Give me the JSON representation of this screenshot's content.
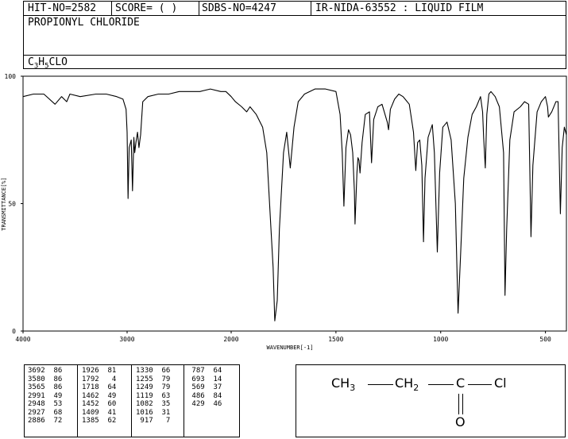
{
  "header": {
    "hit_no": "HIT-NO=2582",
    "score": "SCORE=  (   )",
    "sdbs_no": "SDBS-NO=4247",
    "ir_info": "IR-NIDA-63552 : LIQUID FILM",
    "compound_name": "PROPIONYL CHLORIDE",
    "formula": {
      "c": "C",
      "c_count": "3",
      "h": "H",
      "h_count": "5",
      "rest": "CLO"
    }
  },
  "chart_data": {
    "type": "line",
    "title": "",
    "xlabel": "WAVENUMBER[-1]",
    "ylabel": "TRANSMITTANCE[%]",
    "xlim": [
      4000,
      400
    ],
    "ylim": [
      0,
      100
    ],
    "x_ticks": [
      "4000",
      "3000",
      "2000",
      "1500",
      "1000",
      "500"
    ],
    "x_tick_values": [
      4000,
      3000,
      2000,
      1500,
      1000,
      500
    ],
    "y_ticks": [
      "100",
      "50",
      "0"
    ],
    "y_tick_values": [
      100,
      50,
      0
    ],
    "series": [
      {
        "x": [
          4000,
          3900,
          3800,
          3692,
          3630,
          3580,
          3550,
          3450,
          3300,
          3200,
          3100,
          3040,
          3010,
          3000,
          2991,
          2980,
          2960,
          2948,
          2935,
          2927,
          2915,
          2900,
          2886,
          2870,
          2850,
          2800,
          2700,
          2600,
          2500,
          2400,
          2300,
          2200,
          2100,
          2050,
          2000,
          1980,
          1950,
          1926,
          1910,
          1880,
          1850,
          1830,
          1810,
          1800,
          1792,
          1780,
          1770,
          1750,
          1735,
          1718,
          1700,
          1680,
          1650,
          1600,
          1550,
          1500,
          1480,
          1470,
          1462,
          1455,
          1452,
          1440,
          1430,
          1420,
          1412,
          1409,
          1400,
          1395,
          1390,
          1385,
          1375,
          1360,
          1340,
          1330,
          1320,
          1300,
          1280,
          1255,
          1249,
          1240,
          1220,
          1200,
          1180,
          1150,
          1130,
          1119,
          1110,
          1100,
          1090,
          1082,
          1075,
          1060,
          1040,
          1030,
          1016,
          1005,
          990,
          970,
          950,
          930,
          917,
          905,
          890,
          870,
          850,
          830,
          810,
          800,
          795,
          787,
          780,
          770,
          760,
          740,
          720,
          700,
          693,
          685,
          670,
          650,
          620,
          600,
          580,
          569,
          560,
          540,
          520,
          500,
          490,
          486,
          470,
          450,
          440,
          429,
          420,
          410,
          400
        ],
        "y": [
          92,
          93,
          93,
          89,
          92,
          90,
          93,
          92,
          93,
          93,
          92,
          91,
          87,
          78,
          52,
          72,
          75,
          55,
          76,
          70,
          74,
          78,
          72,
          77,
          90,
          92,
          93,
          93,
          94,
          94,
          94,
          95,
          94,
          94,
          92,
          90,
          88,
          86,
          88,
          85,
          80,
          70,
          40,
          25,
          4,
          12,
          40,
          70,
          78,
          64,
          80,
          90,
          93,
          95,
          95,
          94,
          85,
          70,
          49,
          65,
          72,
          79,
          77,
          70,
          55,
          42,
          62,
          68,
          67,
          62,
          74,
          85,
          86,
          66,
          83,
          88,
          89,
          82,
          79,
          87,
          91,
          93,
          92,
          89,
          78,
          63,
          74,
          75,
          65,
          35,
          60,
          76,
          81,
          70,
          31,
          62,
          80,
          82,
          75,
          50,
          7,
          30,
          60,
          76,
          85,
          88,
          92,
          86,
          76,
          64,
          85,
          93,
          94,
          92,
          88,
          70,
          14,
          40,
          75,
          86,
          88,
          90,
          89,
          37,
          65,
          86,
          90,
          92,
          88,
          84,
          86,
          90,
          90,
          46,
          72,
          80,
          77
        ]
      }
    ]
  },
  "peak_table": [
    [
      [
        "3692",
        "86"
      ],
      [
        "3580",
        "86"
      ],
      [
        "3565",
        "86"
      ],
      [
        "2991",
        "49"
      ],
      [
        "2948",
        "53"
      ],
      [
        "2927",
        "68"
      ],
      [
        "2886",
        "72"
      ]
    ],
    [
      [
        "1926",
        "81"
      ],
      [
        "1792",
        "4"
      ],
      [
        "1718",
        "64"
      ],
      [
        "1462",
        "49"
      ],
      [
        "1452",
        "60"
      ],
      [
        "1409",
        "41"
      ],
      [
        "1385",
        "62"
      ]
    ],
    [
      [
        "1330",
        "66"
      ],
      [
        "1255",
        "79"
      ],
      [
        "1249",
        "79"
      ],
      [
        "1119",
        "63"
      ],
      [
        "1082",
        "35"
      ],
      [
        "1016",
        "31"
      ],
      [
        "917",
        "7"
      ]
    ],
    [
      [
        "787",
        "64"
      ],
      [
        "693",
        "14"
      ],
      [
        "569",
        "37"
      ],
      [
        "486",
        "84"
      ],
      [
        "429",
        "46"
      ]
    ]
  ],
  "structure": {
    "ch3": "CH",
    "ch3_sub": "3",
    "ch2": "CH",
    "ch2_sub": "2",
    "c": "C",
    "cl": "Cl",
    "o": "O"
  }
}
